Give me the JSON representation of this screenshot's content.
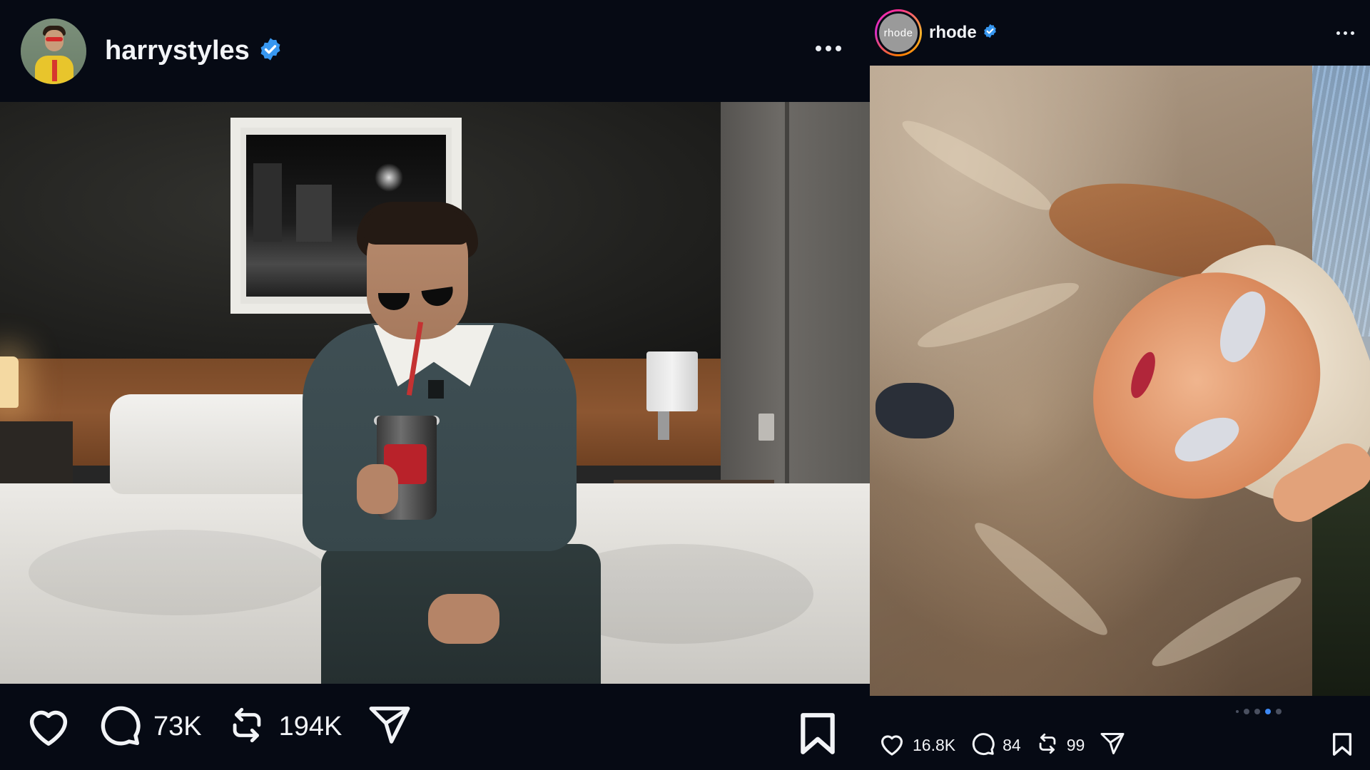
{
  "posts": [
    {
      "username": "harrystyles",
      "verified": true,
      "avatar_icon": "profile-photo",
      "more_icon": "more-horizontal-icon",
      "image_description_icon": "photo",
      "actions": {
        "like_count": "",
        "comment_count": "73K",
        "repost_count": "194K",
        "share_count": ""
      }
    },
    {
      "username": "rhode",
      "avatar_text": "rhode",
      "verified": true,
      "more_icon": "more-horizontal-icon",
      "carousel": {
        "total": 5,
        "active_index": 3
      },
      "actions": {
        "like_count": "16.8K",
        "comment_count": "84",
        "repost_count": "99",
        "share_count": ""
      }
    }
  ],
  "colors": {
    "background": "#060a14",
    "verified_blue": "#3797f0",
    "carousel_active": "#3d89f5",
    "text": "#f2f4f7"
  }
}
